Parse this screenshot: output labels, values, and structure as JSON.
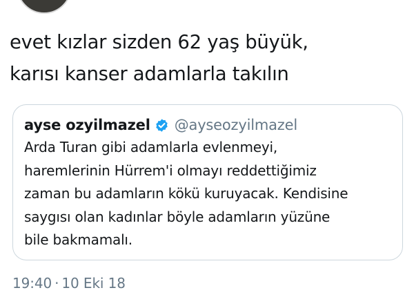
{
  "tweet": {
    "text_lines": [
      "evet kızlar sizden 62 yaş büyük,",
      "karısı kanser adamlarla takılın"
    ]
  },
  "quoted_tweet": {
    "display_name": "ayse ozyilmazel",
    "handle": "@ayseozyilmazel",
    "verified_icon": "verified-badge-icon",
    "text_lines": [
      "Arda Turan gibi adamlarla evlenmeyi,",
      "haremlerinin Hürrem'i olmayı reddettiğimiz",
      "zaman bu adamların kökü kuruyacak. Kendisine",
      "saygısı olan kadınlar böyle adamların yüzüne",
      "bile bakmamalı."
    ]
  },
  "meta": {
    "time": "19:40",
    "separator": "·",
    "date": "10 Eki 18"
  },
  "colors": {
    "text": "#14171a",
    "secondary": "#657786",
    "border": "#ccd6dd",
    "verified": "#1da1f2"
  }
}
